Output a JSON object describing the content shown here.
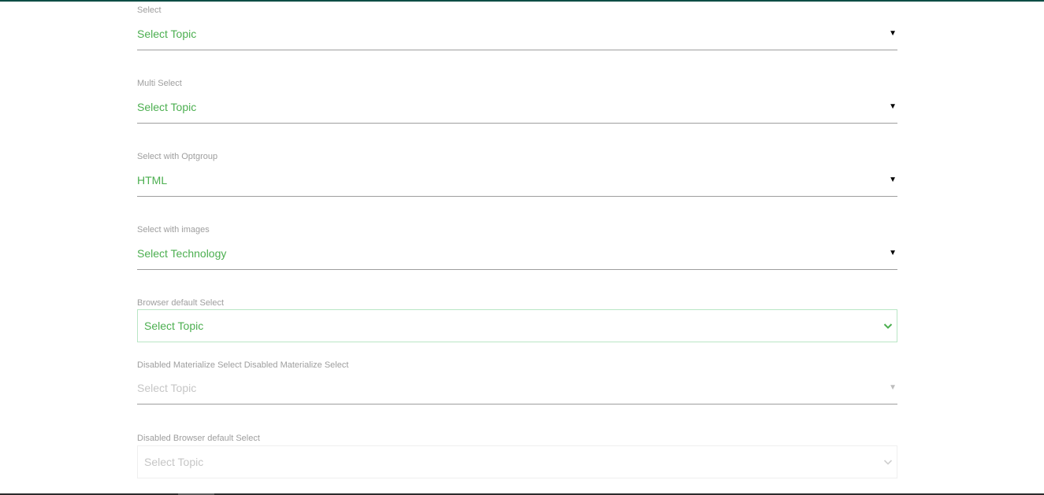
{
  "fields": {
    "select": {
      "label": "Select",
      "value": "Select Topic"
    },
    "multi_select": {
      "label": "Multi Select",
      "value": "Select Topic"
    },
    "optgroup_select": {
      "label": "Select with Optgroup",
      "value": "HTML"
    },
    "images_select": {
      "label": "Select with images",
      "value": "Select Technology"
    },
    "browser_default": {
      "label": "Browser default Select",
      "value": "Select Topic"
    },
    "disabled_materialize": {
      "label": "Disabled Materialize Select Disabled Materialize Select",
      "value": "Select Topic"
    },
    "disabled_browser_default": {
      "label": "Disabled Browser default Select",
      "value": "Select Topic"
    }
  },
  "icons": {
    "caret": "▼",
    "chevron": "chevron-down-icon"
  },
  "colors": {
    "accent": "#4caf50",
    "label": "#9e9e9e",
    "underline": "#9e9e9e",
    "disabled_text": "#c6c6c6",
    "focus_border": "#b9e6c5",
    "top_bar": "#0d4d45"
  }
}
